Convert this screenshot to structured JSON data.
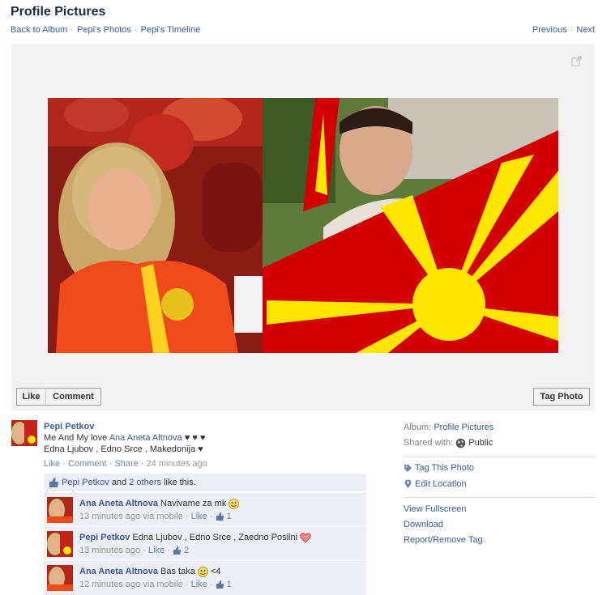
{
  "header": {
    "title": "Profile Pictures",
    "crumbs": [
      "Back to Album",
      "Pepi's Photos",
      "Pepi's Timeline"
    ],
    "previous": "Previous",
    "next": "Next"
  },
  "photo_actions": {
    "like": "Like",
    "comment": "Comment",
    "tag_photo": "Tag Photo"
  },
  "post": {
    "author": "Pepi Petkov",
    "text_prefix": "Me And My love",
    "tagged": "Ana Aneta Altnova",
    "text_hearts": "♥ ♥ ♥",
    "line2": "Edna Ljubov , Edno Srce , Makedonija ♥",
    "action_like": "Like",
    "action_comment": "Comment",
    "action_share": "Share",
    "time": "24 minutes ago"
  },
  "likes_bar": {
    "who": "Pepi Petkov",
    "and": "and",
    "others": "2 others",
    "suffix": "like this."
  },
  "comments": [
    {
      "author": "Ana Aneta Altnova",
      "text": "Navivame za mk",
      "time": "13 minutes ago via mobile",
      "like": "Like",
      "count": "1"
    },
    {
      "author": "Pepi Petkov",
      "text": "Edna Ljubov , Edno Srce , Zaedno Posilni",
      "time": "13 minutes ago",
      "like": "Like",
      "count": "2"
    },
    {
      "author": "Ana Aneta Altnova",
      "text": "Bas taka",
      "text_after": "<4",
      "time": "12 minutes ago via mobile",
      "like": "Like",
      "count": "1"
    }
  ],
  "sidebar": {
    "album_label": "Album:",
    "album_value": "Profile Pictures",
    "shared_label": "Shared with:",
    "shared_value": "Public",
    "tag_this_photo": "Tag This Photo",
    "edit_location": "Edit Location",
    "view_fullscreen": "View Fullscreen",
    "download": "Download",
    "report": "Report/Remove Tag"
  },
  "colors": {
    "link": "#3b5998",
    "flag_red": "#d20000",
    "flag_yellow": "#ffe600",
    "comment_bg": "#eceff5"
  }
}
